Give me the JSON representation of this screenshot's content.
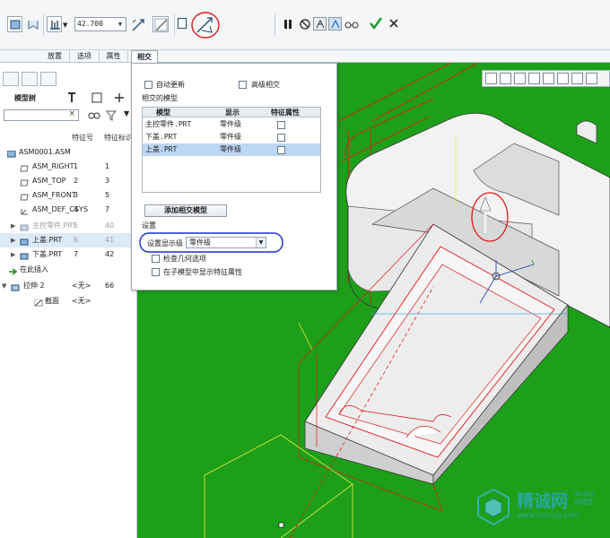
{
  "dashboard": {
    "depth_value": "42.700",
    "icons": [
      "solid-extrude-icon",
      "surface-extrude-icon",
      "depth-option-icon",
      "flip-direction-icon",
      "remove-material-icon",
      "thicken-icon",
      "intersect-flip-icon",
      "pause-icon",
      "no-preview-icon",
      "geometry-preview-icon",
      "feature-preview-icon",
      "verify-icon",
      "ok-checkmark-icon",
      "cancel-x-icon"
    ],
    "accent_ok": "#1a9a2a"
  },
  "tabs": [
    {
      "label": "放置"
    },
    {
      "label": "选项"
    },
    {
      "label": "属性"
    },
    {
      "label": "相交"
    }
  ],
  "model_tree": {
    "title": "模型树",
    "search_placeholder": "",
    "columns": [
      "特征号",
      "特征标识"
    ],
    "rows": [
      {
        "name": "ASM0001.ASM",
        "c1": "",
        "c2": "",
        "icon": "assembly-icon"
      },
      {
        "name": "ASM_RIGHT",
        "c1": "1",
        "c2": "1",
        "icon": "datum-plane-icon"
      },
      {
        "name": "ASM_TOP",
        "c1": "2",
        "c2": "3",
        "icon": "datum-plane-icon"
      },
      {
        "name": "ASM_FRONT",
        "c1": "3",
        "c2": "5",
        "icon": "datum-plane-icon"
      },
      {
        "name": "ASM_DEF_CSYS",
        "c1": "4",
        "c2": "7",
        "icon": "csys-icon"
      },
      {
        "name": "主控零件.PRT",
        "c1": "5",
        "c2": "40",
        "icon": "part-icon"
      },
      {
        "name": "上盖.PRT",
        "c1": "6",
        "c2": "41",
        "icon": "part-icon"
      },
      {
        "name": "下盖.PRT",
        "c1": "7",
        "c2": "42",
        "icon": "part-icon"
      },
      {
        "name": "在此插入",
        "c1": "",
        "c2": "",
        "icon": "insert-arrow-icon"
      },
      {
        "name": "拉伸 2",
        "c1": "<无>",
        "c2": "66",
        "icon": "extrude-icon"
      },
      {
        "name": "截面",
        "c1": "<无>",
        "c2": "",
        "icon": "sketch-icon"
      }
    ]
  },
  "intersect_panel": {
    "auto_update_label": "自动更新",
    "advanced_intersect_label": "高级相交",
    "intersected_models_label": "相交的模型",
    "table_headers": [
      "模型",
      "显示",
      "特征属性"
    ],
    "table_rows": [
      {
        "model": "主控零件.PRT",
        "display": "零件级"
      },
      {
        "model": "下盖.PRT",
        "display": "零件级"
      },
      {
        "model": "上盖.PRT",
        "display": "零件级"
      }
    ],
    "add_button_label": "添加相交模型",
    "settings_label": "设置",
    "display_level_label": "设置显示级",
    "display_level_value": "零件级",
    "check_geometry_label": "检查几何选项",
    "show_in_sub_label": "在子模型中显示特征属性"
  },
  "watermark": {
    "brand": "精诚网",
    "url": "www.cnsoug.com",
    "tagline_1": "3D设计",
    "tagline_2": "师联盟"
  },
  "colors": {
    "viewport_bg": "#1d9f1a",
    "annotation_red": "#e01a1a",
    "annotation_blue": "#1a2fd0",
    "selection_blue": "#bcd7f2"
  }
}
